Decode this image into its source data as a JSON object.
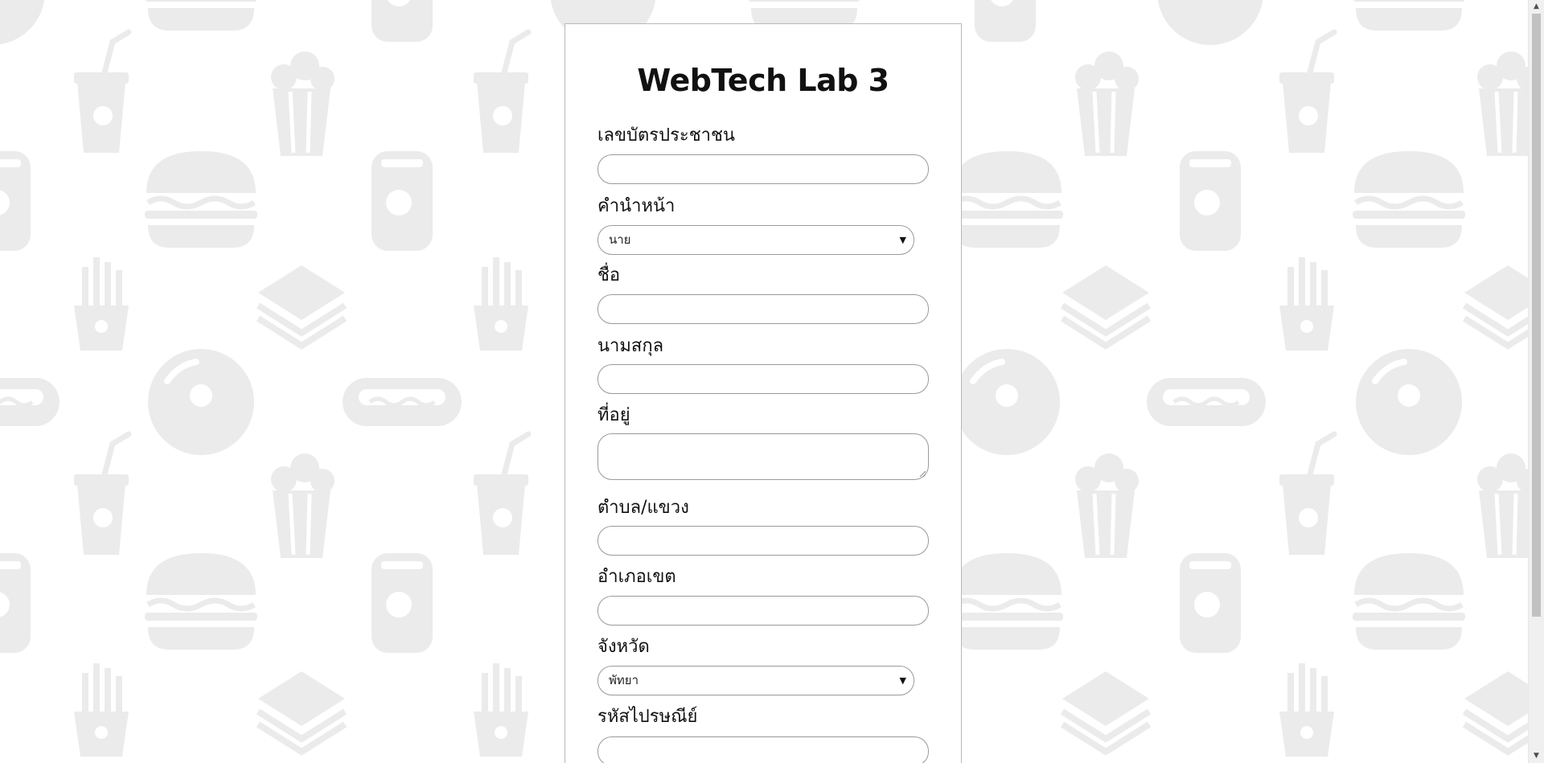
{
  "page": {
    "title": "WebTech Lab 3"
  },
  "form": {
    "citizen_id_label": "เลขบัตรประชาชน",
    "citizen_id_value": "",
    "prefix_label": "คำนำหน้า",
    "prefix_selected": "นาย",
    "first_name_label": "ชื่อ",
    "first_name_value": "",
    "last_name_label": "นามสกุล",
    "last_name_value": "",
    "address_label": "ที่อยู่",
    "address_value": "",
    "subdistrict_label": "ตำบล/แขวง",
    "subdistrict_value": "",
    "district_label": "อำเภอเขต",
    "district_value": "",
    "province_label": "จังหวัด",
    "province_selected": "พัทยา",
    "postal_code_label": "รหัสไปรษณีย์",
    "postal_code_value": ""
  },
  "icons": {
    "background_pattern": [
      "donut-icon",
      "cup-icon",
      "popcorn-icon",
      "burger-icon",
      "can-icon",
      "fries-icon",
      "sandwich-icon",
      "hotdog-icon"
    ],
    "select_arrow": "triangle-down-icon",
    "scroll_up": "scroll-up-arrow-icon",
    "scroll_down": "scroll-down-arrow-icon"
  },
  "colors": {
    "background": "#ffffff",
    "pattern": "#ebebeb",
    "card_border": "#b8b8b8",
    "field_border": "#9a9a9a",
    "text": "#111111"
  }
}
